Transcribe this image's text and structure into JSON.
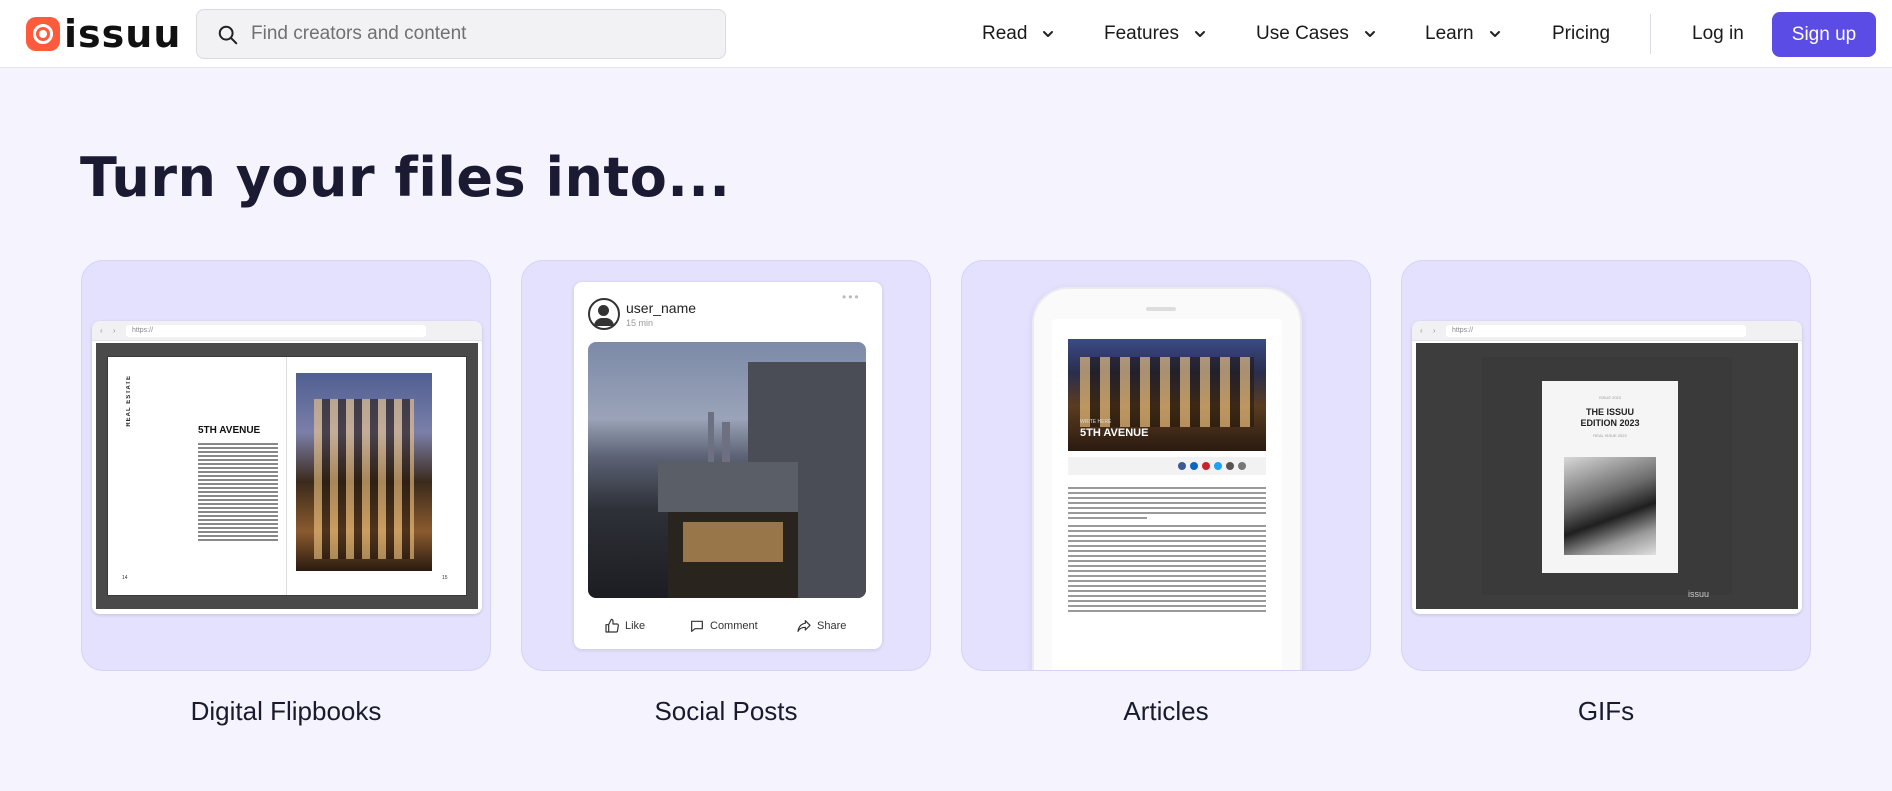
{
  "header": {
    "logo_text": "issuu",
    "search_placeholder": "Find creators and content",
    "nav": [
      {
        "label": "Read"
      },
      {
        "label": "Features"
      },
      {
        "label": "Use Cases"
      },
      {
        "label": "Learn"
      },
      {
        "label": "Pricing"
      }
    ],
    "login_label": "Log in",
    "signup_label": "Sign up"
  },
  "heading": "Turn your files into...",
  "cards": [
    {
      "label": "Digital Flipbooks",
      "preview": {
        "url": "https://",
        "vertical_text": "REAL ESTATE",
        "title": "5TH AVENUE",
        "page_left": "14",
        "page_right": "15"
      }
    },
    {
      "label": "Social Posts",
      "preview": {
        "user": "user_name",
        "time": "15 min",
        "actions": [
          "Like",
          "Comment",
          "Share"
        ]
      }
    },
    {
      "label": "Articles",
      "preview": {
        "kicker": "WRITE HERE",
        "title": "5TH AVENUE"
      }
    },
    {
      "label": "GIFs",
      "preview": {
        "url": "https://",
        "small": "ISSUE 2023",
        "title_line1": "THE ISSUU",
        "title_line2": "EDITION 2023",
        "sub": "REAL ISSUE 2023",
        "logo": "issuu"
      }
    }
  ],
  "colors": {
    "accent": "#5b4ce5",
    "logo_mark": "#ff5a3c",
    "page_bg": "#f4f3fe",
    "card_bg": "#e3e1fd"
  }
}
